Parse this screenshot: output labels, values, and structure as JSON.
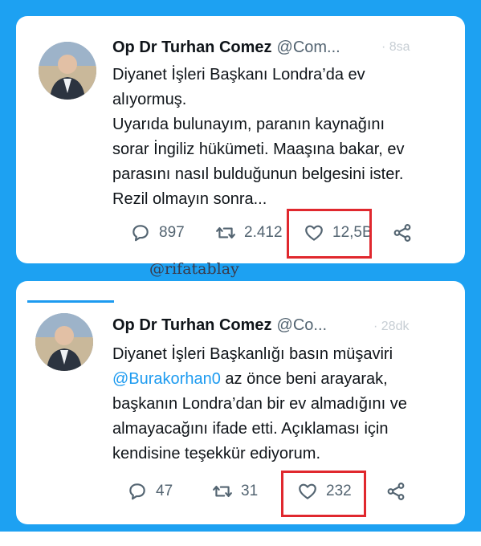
{
  "tweets": [
    {
      "name": "Op Dr Turhan Comez",
      "handle": "@Com...",
      "faded_meta": "· 8sa",
      "body_lines": [
        "Diyanet İşleri Başkanı Londra’da ev",
        "alıyormuş.",
        "Uyarıda bulunayım, paranın kaynağını",
        "sorar İngiliz hükümeti. Maaşına bakar, ev",
        "parasını nasıl bulduğunun belgesini ister.",
        "Rezil olmayın sonra..."
      ],
      "replies": "897",
      "retweets": "2.412",
      "likes": "12,5B"
    },
    {
      "name": "Op Dr Turhan Comez",
      "handle": "@Co...",
      "faded_meta": "· 28dk",
      "body_lines": [
        "Diyanet İşleri Başkanlığı basın müşaviri",
        "az önce beni arayarak,",
        "başkanın Londra’dan bir ev almadığını ve",
        "almayacağını ifade etti. Açıklaması için",
        "kendisine teşekkür ediyorum."
      ],
      "mention": "@Burakorhan0",
      "replies": "47",
      "retweets": "31",
      "likes": "232"
    }
  ],
  "watermark": "@rifatablay",
  "colors": {
    "background": "#1DA1F2",
    "highlight_box": "#e0282e",
    "mention": "#1d9bf0",
    "icon_gray": "#536471"
  },
  "icons": [
    "reply-icon",
    "retweet-icon",
    "like-icon",
    "share-icon"
  ]
}
